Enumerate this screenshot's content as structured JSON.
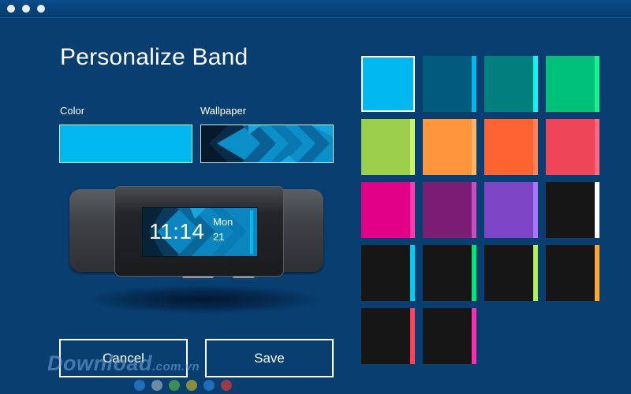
{
  "title": "Personalize Band",
  "labels": {
    "color": "Color",
    "wallpaper": "Wallpaper"
  },
  "selected_color": "#00b8ee",
  "band": {
    "time": "11:14",
    "day": "Mon",
    "date": "21"
  },
  "buttons": {
    "cancel": "Cancel",
    "save": "Save"
  },
  "swatches": [
    {
      "fill": "#00b8ee",
      "accent": "#00b8ee",
      "selected": true
    },
    {
      "fill": "#005b7c",
      "accent": "#00b8ee"
    },
    {
      "fill": "#007f7f",
      "accent": "#13f2f2"
    },
    {
      "fill": "#00c17a",
      "accent": "#19f190"
    },
    {
      "fill": "#9ccf4b",
      "accent": "#c8f26a"
    },
    {
      "fill": "#ff963c",
      "accent": "#ffb365"
    },
    {
      "fill": "#ff6332",
      "accent": "#ff8255"
    },
    {
      "fill": "#ee4558",
      "accent": "#ff6a80"
    },
    {
      "fill": "#e10087",
      "accent": "#ff3aac"
    },
    {
      "fill": "#7b1d72",
      "accent": "#c94cc0"
    },
    {
      "fill": "#7b45c5",
      "accent": "#a778ff"
    },
    {
      "fill": "#161616",
      "accent": "#ffffff"
    },
    {
      "fill": "#161616",
      "accent": "#00cdf0"
    },
    {
      "fill": "#161616",
      "accent": "#00e676"
    },
    {
      "fill": "#161616",
      "accent": "#b1f05a"
    },
    {
      "fill": "#161616",
      "accent": "#ffa832"
    },
    {
      "fill": "#161616",
      "accent": "#ff4356"
    },
    {
      "fill": "#161616",
      "accent": "#ff2db4"
    }
  ],
  "watermark": {
    "main": "Download",
    "suffix": ".com.vn"
  },
  "watermark_dot_colors": [
    "#1f6fb8",
    "#6c8aa6",
    "#3e8d55",
    "#8a8c3a",
    "#1f6fb8",
    "#9c3a45"
  ]
}
